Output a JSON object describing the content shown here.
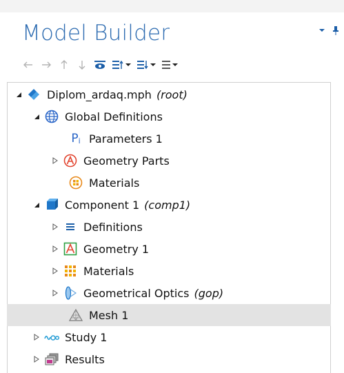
{
  "panel": {
    "title": "Model Builder"
  },
  "tree": {
    "root": {
      "label": "Diplom_ardaq.mph",
      "tag": "(root)"
    },
    "global_definitions": {
      "label": "Global Definitions"
    },
    "parameters": {
      "label": "Parameters 1",
      "icon_text": "P",
      "icon_sub": "i"
    },
    "geometry_parts": {
      "label": "Geometry Parts"
    },
    "global_materials": {
      "label": "Materials"
    },
    "component": {
      "label": "Component 1",
      "tag": "(comp1)"
    },
    "definitions": {
      "label": "Definitions"
    },
    "geometry": {
      "label": "Geometry 1"
    },
    "materials": {
      "label": "Materials"
    },
    "geometrical_optics": {
      "label": "Geometrical Optics",
      "tag": "(gop)"
    },
    "mesh": {
      "label": "Mesh 1"
    },
    "study": {
      "label": "Study 1"
    },
    "results": {
      "label": "Results"
    }
  },
  "colors": {
    "title": "#2b6ab0",
    "selected_row": "#e3e3e3",
    "border": "#cfcfcf"
  },
  "icons": {
    "toolbar": [
      "arrow-left-icon",
      "arrow-right-icon",
      "arrow-up-icon",
      "arrow-down-icon",
      "show-icon",
      "sort-up-icon",
      "sort-down-icon",
      "list-icon"
    ],
    "panel": [
      "chevron-down-icon",
      "pin-icon"
    ]
  }
}
